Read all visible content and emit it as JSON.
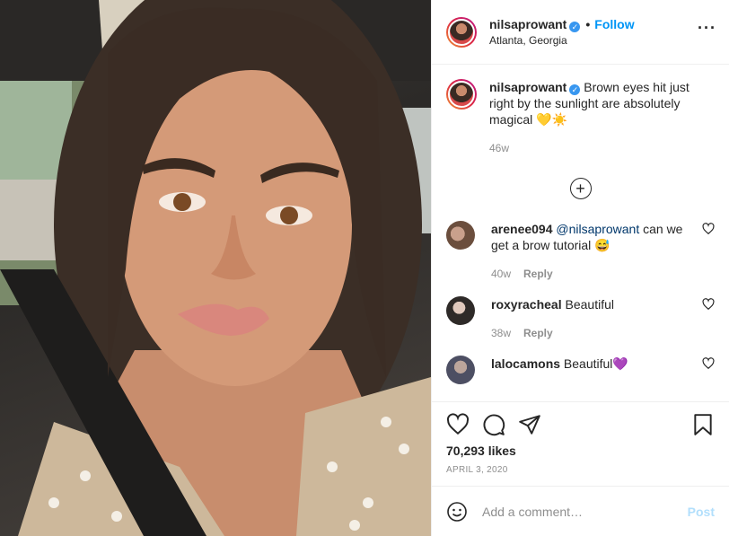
{
  "post": {
    "username": "nilsaprowant",
    "verified_icon": "verified-badge-icon",
    "follow_label": "Follow",
    "separator": "•",
    "location": "Atlanta, Georgia",
    "more_icon": "more-options-icon",
    "image_alt_description_icon": "selfie-photo"
  },
  "caption": {
    "username": "nilsaprowant",
    "text": "Brown eyes hit just right by the sunlight are absolutely magical 💛☀️",
    "age": "46w"
  },
  "load_more_icon": "plus-circle-icon",
  "comments": [
    {
      "username": "arenee094",
      "mention": "@nilsaprowant",
      "text": " can we get a brow tutorial 😅",
      "age": "40w",
      "reply_label": "Reply",
      "avatar_color": "#6b4e3d"
    },
    {
      "username": "roxyracheal",
      "mention": "",
      "text": " Beautiful",
      "age": "38w",
      "reply_label": "Reply",
      "avatar_color": "#2e2a28"
    },
    {
      "username": "lalocamons",
      "mention": "",
      "text": " Beautiful💜",
      "age": "",
      "reply_label": "",
      "avatar_color": "#4d4f63"
    }
  ],
  "actions": {
    "like_icon": "heart-icon",
    "comment_icon": "comment-icon",
    "share_icon": "share-icon",
    "save_icon": "bookmark-icon",
    "likes": "70,293 likes",
    "date": "APRIL 3, 2020"
  },
  "add_comment": {
    "emoji_icon": "emoji-icon",
    "placeholder": "Add a comment…",
    "post_label": "Post"
  },
  "colors": {
    "accent": "#0095f6",
    "post_disabled": "#b2dffc",
    "muted": "#8e8e8e"
  }
}
